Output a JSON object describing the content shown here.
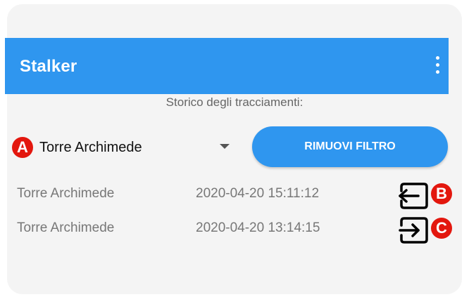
{
  "app": {
    "title": "Stalker",
    "menu_icon": "more-vert-icon"
  },
  "history": {
    "subtitle": "Storico degli tracciamenti:"
  },
  "filter": {
    "selected": "Torre Archimede",
    "remove_label": "RIMUOVI FILTRO"
  },
  "entries": [
    {
      "place": "Torre Archimede",
      "time": "2020-04-20 15:11:12",
      "icon": "exit-icon"
    },
    {
      "place": "Torre Archimede",
      "time": "2020-04-20 13:14:15",
      "icon": "enter-icon"
    }
  ],
  "markers": {
    "a": "A",
    "b": "B",
    "c": "C"
  },
  "colors": {
    "primary": "#2f96ef",
    "marker": "#e3170e",
    "row_text": "#777777"
  }
}
